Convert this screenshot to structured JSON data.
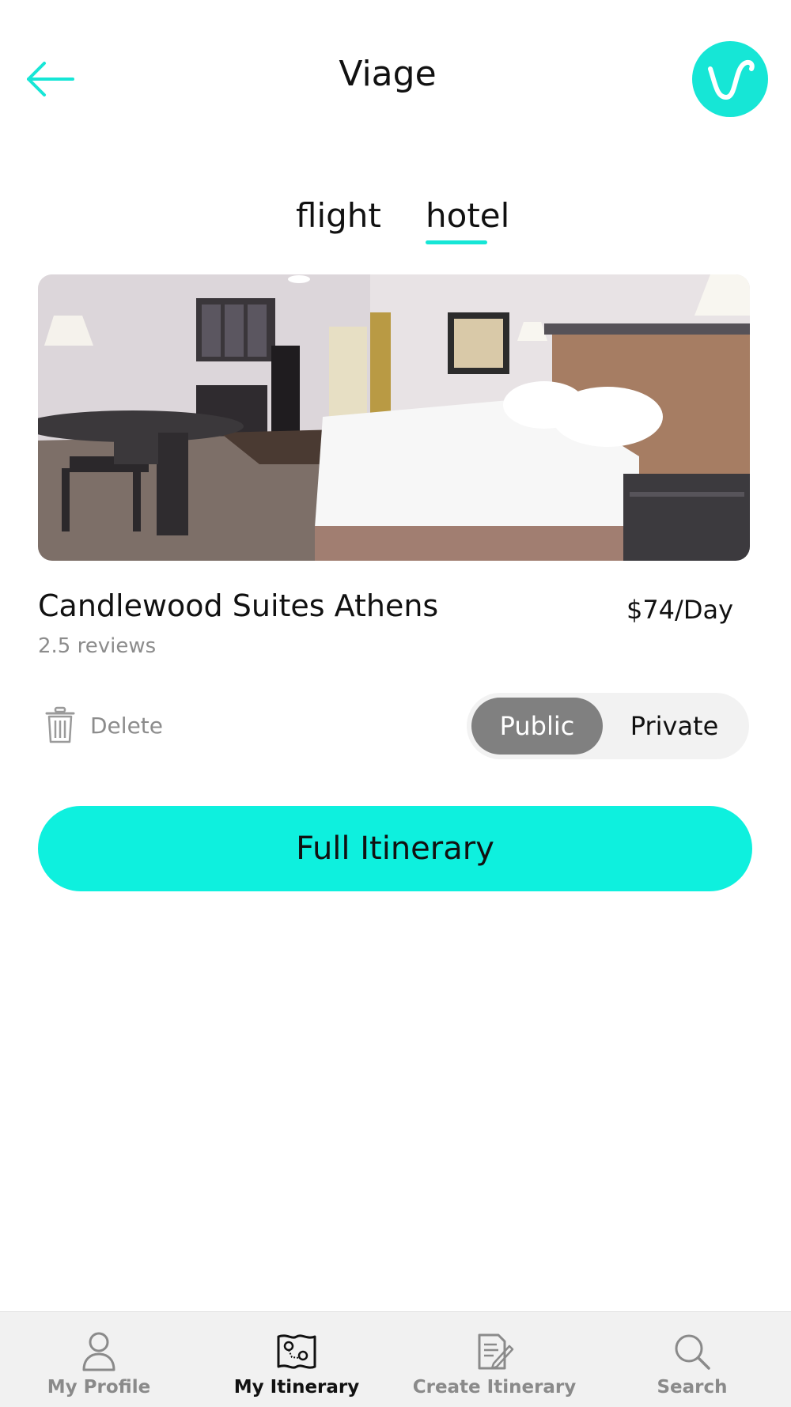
{
  "header": {
    "title": "Viage",
    "back_icon": "arrow-left-icon",
    "logo_icon": "viage-logo-icon",
    "accent_color": "#16e6d6"
  },
  "tabs": [
    {
      "label": "flight",
      "active": false
    },
    {
      "label": "hotel",
      "active": true
    }
  ],
  "hotel": {
    "name": "Candlewood Suites Athens",
    "reviews": "2.5 reviews",
    "price": "$74/Day"
  },
  "actions": {
    "delete_label": "Delete",
    "visibility": {
      "options": [
        "Public",
        "Private"
      ],
      "selected": "Public"
    },
    "cta_label": "Full Itinerary",
    "cta_color": "#0ef0de"
  },
  "bottom_nav": [
    {
      "label": "My Profile",
      "icon": "user-icon",
      "active": false
    },
    {
      "label": "My Itinerary",
      "icon": "map-pin-icon",
      "active": true
    },
    {
      "label": "Create Itinerary",
      "icon": "edit-document-icon",
      "active": false
    },
    {
      "label": "Search",
      "icon": "search-icon",
      "active": false
    }
  ]
}
